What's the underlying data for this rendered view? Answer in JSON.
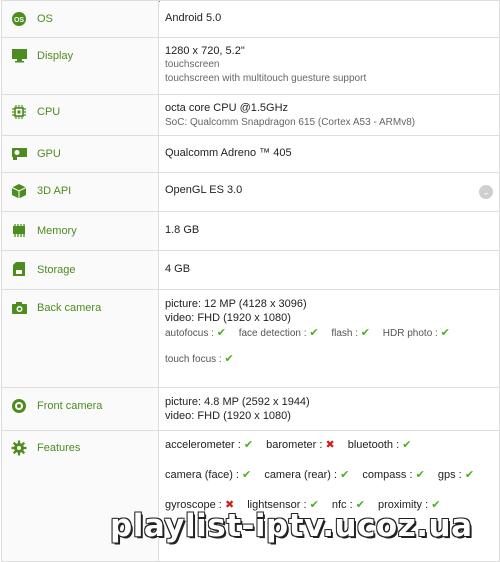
{
  "rows": {
    "os": {
      "label": "OS",
      "icon": "os-icon",
      "lines": [
        "Android 5.0"
      ]
    },
    "display": {
      "label": "Display",
      "icon": "monitor-icon",
      "main": "1280 x 720, 5.2\"",
      "sub1": "touchscreen",
      "sub2": "touchscreen with multitouch guesture support"
    },
    "cpu": {
      "label": "CPU",
      "icon": "cpu-chip-icon",
      "main": "octa core CPU @1.5GHz",
      "sub": "SoC: Qualcomm Snapdragon 615 (Cortex A53 - ARMv8)"
    },
    "gpu": {
      "label": "GPU",
      "icon": "gpu-card-icon",
      "main": "Qualcomm Adreno ™ 405"
    },
    "api3d": {
      "label": "3D API",
      "icon": "cube-icon",
      "main": "OpenGL ES 3.0",
      "expand": "⌄"
    },
    "memory": {
      "label": "Memory",
      "icon": "memory-ram-icon",
      "main": "1.8 GB"
    },
    "storage": {
      "label": "Storage",
      "icon": "sd-card-icon",
      "main": "4 GB"
    },
    "back_camera": {
      "label": "Back camera",
      "icon": "camera-icon",
      "line1": "picture: 12 MP (4128 x 3096)",
      "line2": "video: FHD (1920 x 1080)",
      "features": [
        {
          "name": "autofocus :",
          "status": "yes"
        },
        {
          "name": "face detection :",
          "status": "yes"
        },
        {
          "name": "flash :",
          "status": "yes"
        },
        {
          "name": "HDR photo :",
          "status": "yes"
        },
        {
          "name": "touch focus :",
          "status": "yes"
        }
      ]
    },
    "front_camera": {
      "label": "Front camera",
      "icon": "front-camera-icon",
      "line1": "picture: 4.8 MP (2592 x 1944)",
      "line2": "video: FHD (1920 x 1080)"
    },
    "features": {
      "label": "Features",
      "icon": "gear-icon",
      "items": [
        {
          "name": "accelerometer :",
          "status": "yes"
        },
        {
          "name": "barometer :",
          "status": "no"
        },
        {
          "name": "bluetooth :",
          "status": "yes"
        },
        {
          "name": "camera (face) :",
          "status": "yes"
        },
        {
          "name": "camera (rear) :",
          "status": "yes"
        },
        {
          "name": "compass :",
          "status": "yes"
        },
        {
          "name": "gps :",
          "status": "yes"
        },
        {
          "name": "gyroscope :",
          "status": "no"
        },
        {
          "name": "lightsensor :",
          "status": "yes"
        },
        {
          "name": "nfc :",
          "status": "yes"
        },
        {
          "name": "proximity :",
          "status": "yes"
        }
      ]
    }
  },
  "symbols": {
    "yes": "✔",
    "no": "✖"
  },
  "watermark": "playlist-iptv.ucoz.ua",
  "colors": {
    "label_green": "#4d8c1f",
    "check_green": "#4caf22",
    "cross_red": "#cc2222"
  }
}
